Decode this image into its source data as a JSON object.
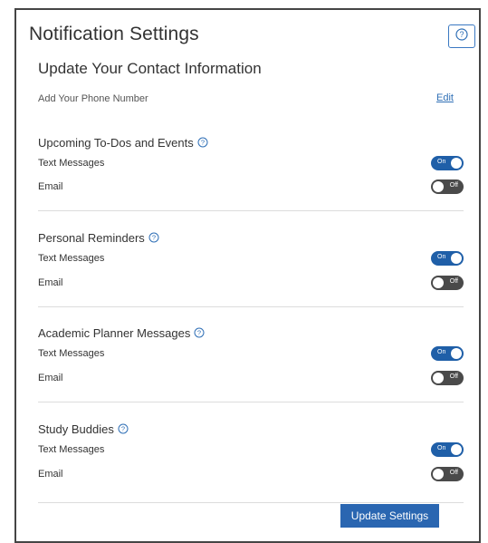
{
  "header": {
    "title": "Notification Settings",
    "help_icon": "question-circle-icon"
  },
  "contact": {
    "title": "Update Your Contact Information",
    "phone_label": "Add Your Phone Number",
    "edit_label": "Edit"
  },
  "sections": [
    {
      "title": "Upcoming To-Dos and Events",
      "rows": [
        {
          "label": "Text Messages",
          "state": "On"
        },
        {
          "label": "Email",
          "state": "Off"
        }
      ]
    },
    {
      "title": "Personal Reminders",
      "rows": [
        {
          "label": "Text Messages",
          "state": "On"
        },
        {
          "label": "Email",
          "state": "Off"
        }
      ]
    },
    {
      "title": "Academic Planner Messages",
      "rows": [
        {
          "label": "Text Messages",
          "state": "On"
        },
        {
          "label": "Email",
          "state": "Off"
        }
      ]
    },
    {
      "title": "Study Buddies",
      "rows": [
        {
          "label": "Text Messages",
          "state": "On"
        },
        {
          "label": "Email",
          "state": "Off"
        }
      ]
    }
  ],
  "footer": {
    "update_label": "Update Settings"
  },
  "colors": {
    "accent": "#2a66b1",
    "toggle_on": "#1f5fa8",
    "toggle_off": "#4a4a4a",
    "link": "#2f6fb6"
  }
}
